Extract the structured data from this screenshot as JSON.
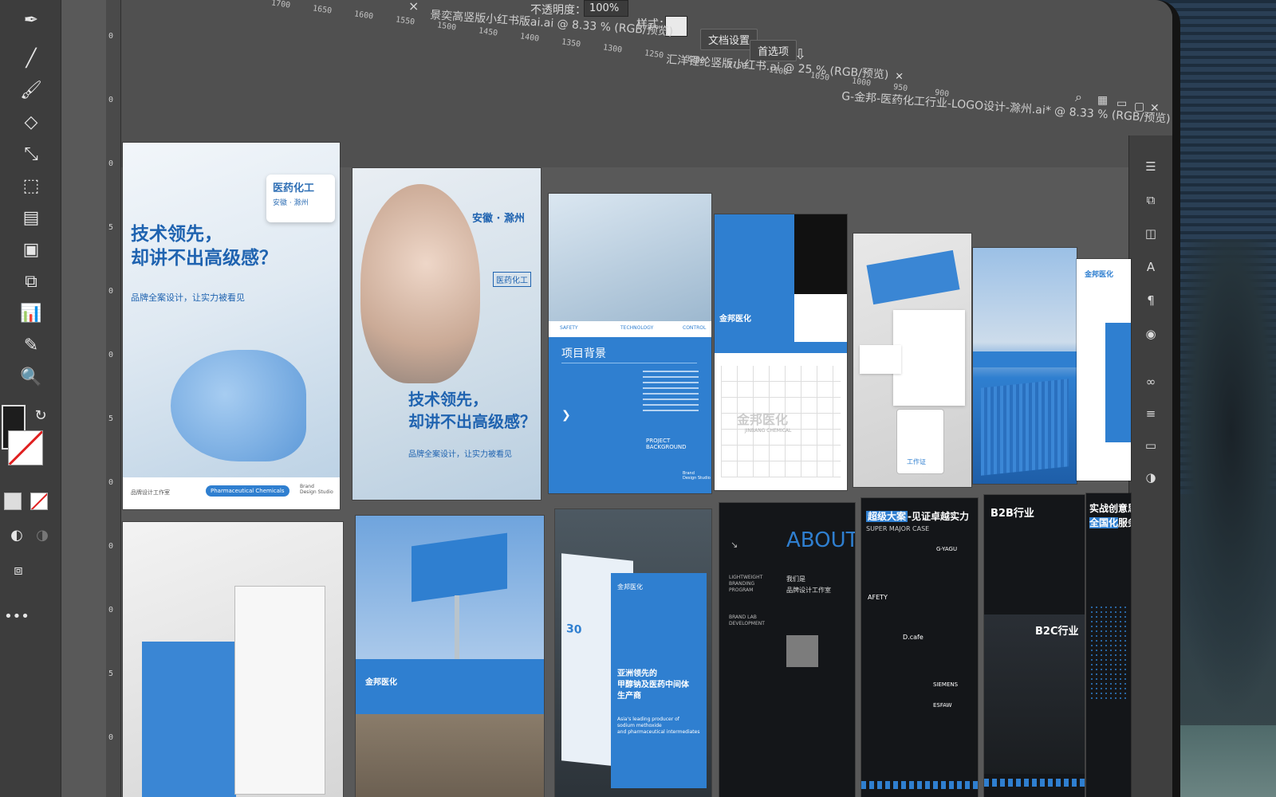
{
  "app": {
    "tabs": [
      {
        "label": "景奕高竖版小红书版ai.ai @ 8.33 % (RGB/预览)",
        "close": "×"
      },
      {
        "label": "汇洋锂纶竖版小红书.ai @ 25 % (RGB/预览)",
        "close": "×"
      },
      {
        "label": "G-金邦-医药化工行业-LOGO设计-滁州.ai* @ 8.33 % (RGB/预览)",
        "close": "×"
      }
    ],
    "opacity_label": "不透明度：",
    "opacity_value": "100%",
    "style_label": "样式：",
    "doc_settings_button": "文档设置",
    "preferences_button": "首选项",
    "top_close": "×"
  },
  "ruler": {
    "horizontal": [
      "1700",
      "1650",
      "1600",
      "1550",
      "1500",
      "1450",
      "1400",
      "1350",
      "1300",
      "1250",
      "1200",
      "1150",
      "1100",
      "1050",
      "1000",
      "950",
      "900"
    ],
    "vertical": [
      "0",
      "0",
      "0",
      "5",
      "0",
      "0",
      "5",
      "0",
      "0",
      "0",
      "5",
      "0"
    ]
  },
  "artboards": {
    "a1": {
      "tag": "医药化工",
      "tag_sub": "安徽 · 滁州",
      "headline": "技术领先，\n却讲不出高级感？",
      "sub": "品牌全案设计，让实力被看见",
      "footer_left": "品牌设计工作室",
      "footer_pill": "Pharmaceutical Chemicals",
      "footer_right": "Brand\nDesign Studio"
    },
    "a2": {
      "location": "安徽 · 滁州",
      "tag": "医药化工",
      "headline": "技术领先，\n却讲不出高级感？",
      "sub": "品牌全案设计，让实力被看见"
    },
    "a3": {
      "row": [
        "SAFETY",
        "TECHNOLOGY",
        "CONTROL"
      ],
      "title": "项目背景",
      "footer": "PROJECT BACKGROUND",
      "footer_right": "Brand\nDesign Studio"
    },
    "a4": {
      "logo": "金邦医化",
      "logo_en": "JINBANG CHEMICAL"
    },
    "a5": {
      "card": "工作证"
    },
    "a8": {
      "about": "ABOUT",
      "lines": [
        "LIGHTWEIGHT\nBRANDING\nPROGRAM",
        "BRAND LAB\nDEVELOPMENT"
      ],
      "cn": [
        "我们是",
        "品牌设计工作室"
      ]
    },
    "a9": {
      "title_hl": "超级大案",
      "title": "-见证卓越实力",
      "sub": "SUPER MAJOR CASE",
      "logos": [
        "AFETY",
        "D.cafe",
        "SIEMENS",
        "ESFAW",
        "G-YAGU"
      ]
    },
    "a10": {
      "b2b": "B2B行业",
      "b2c": "B2C行业"
    },
    "a11": {
      "title1": "实战创意思维",
      "title2_hl": "全国化",
      "title2": "服务格"
    },
    "a13": {
      "num": "30",
      "line": "亚洲领先的\n甲醇钠及医药中间体\n生产商",
      "en": "Asia's leading producer of\nsodium methoxide\nand pharmaceutical intermediates"
    }
  }
}
